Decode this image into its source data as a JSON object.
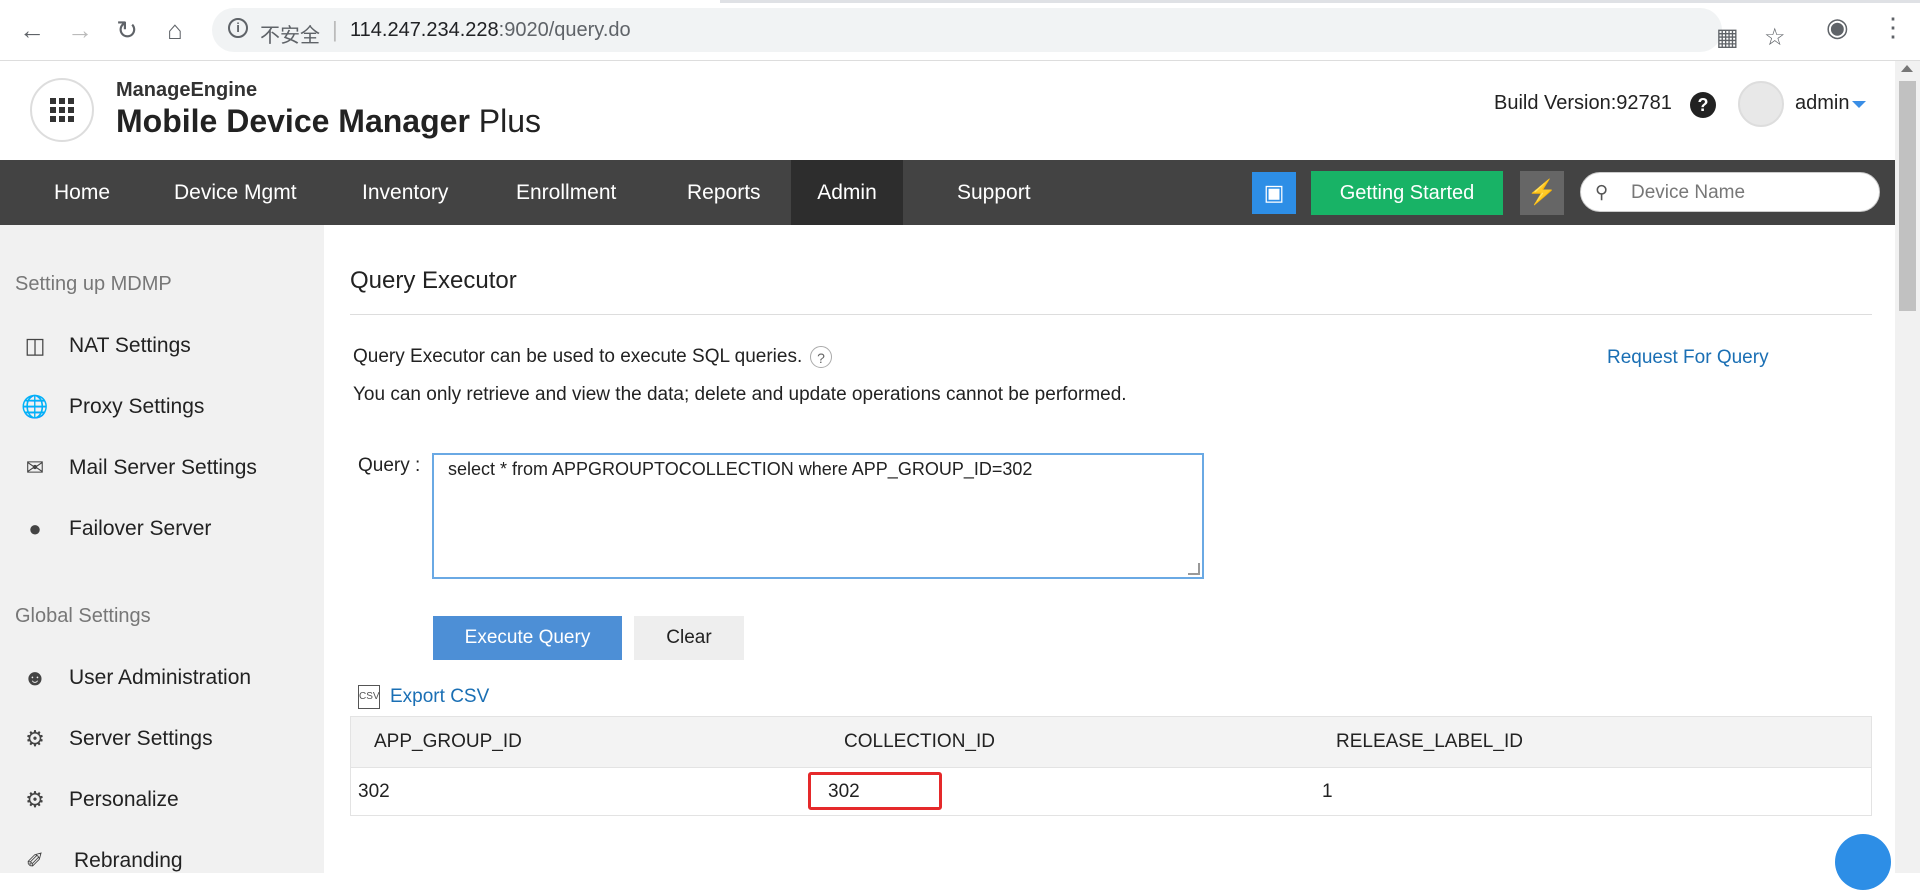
{
  "browser": {
    "security_label": "不安全",
    "url_host": "114.247.234.228",
    "url_rest": ":9020/query.do"
  },
  "header": {
    "brand_top": "ManageEngine",
    "brand_main": "Mobile Device Manager",
    "brand_plus": "Plus",
    "build_version": "Build Version:92781",
    "user_name": "admin"
  },
  "nav": {
    "items": [
      "Home",
      "Device Mgmt",
      "Inventory",
      "Enrollment",
      "Reports",
      "Admin",
      "Support"
    ],
    "active": "Admin",
    "getting_started": "Getting Started",
    "search_placeholder": "Device Name"
  },
  "sidebar": {
    "section1": "Setting up MDMP",
    "items1": [
      "NAT Settings",
      "Proxy Settings",
      "Mail Server Settings",
      "Failover Server"
    ],
    "section2": "Global Settings",
    "items2": [
      "User Administration",
      "Server Settings",
      "Personalize",
      "Rebranding"
    ]
  },
  "main": {
    "title": "Query Executor",
    "desc1": "Query Executor can be used to execute SQL queries.",
    "desc2": "You can only retrieve and view the data; delete and update operations cannot be performed.",
    "request_link": "Request For Query",
    "query_label": "Query :",
    "query_value": "select * from APPGROUPTOCOLLECTION where APP_GROUP_ID=302",
    "execute_label": "Execute Query",
    "clear_label": "Clear",
    "export_label": "Export CSV",
    "columns": [
      "APP_GROUP_ID",
      "COLLECTION_ID",
      "RELEASE_LABEL_ID"
    ],
    "rows": [
      [
        "302",
        "302",
        "1"
      ]
    ]
  },
  "colors": {
    "nav_bg": "#434343",
    "nav_active_bg": "#2d2d2d",
    "getting_started_bg": "#18b366",
    "accent_blue": "#4d8fd6",
    "link_blue": "#1a6fb4",
    "highlight_red": "#e5292a"
  },
  "icons": [
    "back-icon",
    "forward-icon",
    "reload-icon",
    "home-icon",
    "info-icon",
    "translate-icon",
    "star-icon",
    "account-icon",
    "more-icon",
    "app-grid-icon",
    "help-icon",
    "presentation-icon",
    "bolt-icon",
    "search-icon",
    "nat-icon",
    "globe-icon",
    "mail-server-icon",
    "failover-icon",
    "user-icon",
    "server-settings-icon",
    "gears-icon",
    "palette-icon",
    "csv-icon",
    "chat-icon"
  ]
}
